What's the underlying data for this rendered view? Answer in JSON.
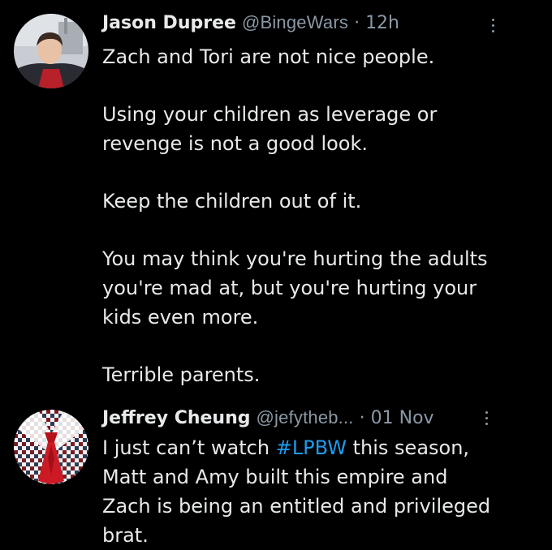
{
  "tweets": [
    {
      "author_name": "Jason Dupree",
      "handle": "@BingeWars",
      "separator": "·",
      "time": "12h",
      "avatar_icon": "user-avatar-photo",
      "more_icon": "more-options-icon",
      "paragraphs": [
        [
          "Zach and Tori are not nice people."
        ],
        [
          "Using your children as leverage or",
          "revenge is not a good look."
        ],
        [
          "Keep the children out of it."
        ],
        [
          "You may think you're hurting the adults",
          "you're mad at, but you're hurting your",
          "kids even more."
        ],
        [
          "Terrible parents."
        ]
      ]
    },
    {
      "author_name": "Jeffrey Cheung",
      "handle": "@jefytheb...",
      "separator": "·",
      "time": "01 Nov",
      "avatar_icon": "user-avatar-photo",
      "more_icon": "more-options-icon",
      "text_before_hashtag": "I just can’t watch ",
      "hashtag": "#LPBW",
      "text_after_hashtag": " this season,",
      "lines": [
        "Matt and Amy built this empire and",
        "Zach is being an entitled and privileged",
        "brat."
      ]
    }
  ],
  "colors": {
    "background": "#000000",
    "primary_text": "#e7e9ea",
    "secondary_text": "#8b98a5",
    "link": "#1d9bf0"
  }
}
